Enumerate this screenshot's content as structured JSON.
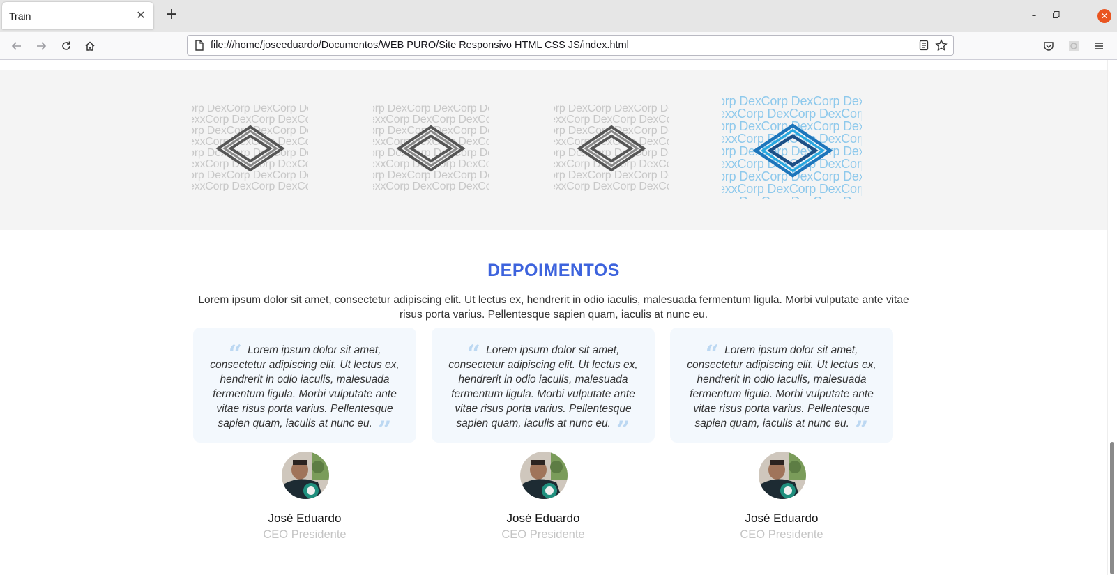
{
  "browser": {
    "tab_title": "Train",
    "tab_close": "✕",
    "new_tab": "+",
    "url": "file:///home/joseeduardo/Documentos/WEB PURO/Site Responsivo HTML CSS JS/index.html",
    "window_controls": {
      "minimize": "–",
      "maximize": "▫",
      "close": "✕"
    }
  },
  "logos": {
    "pattern_word": "DexCorp",
    "pattern_first_fragment": "orp",
    "tiles": [
      {
        "state": "grayscale",
        "stroke": "#555555"
      },
      {
        "state": "grayscale",
        "stroke": "#555555"
      },
      {
        "state": "grayscale",
        "stroke": "#555555"
      },
      {
        "state": "color",
        "stroke_primary": "#1d75bb",
        "stroke_secondary": "#29a8e0",
        "stroke_dark": "#1c4f86"
      }
    ]
  },
  "testimonials": {
    "title": "DEPOIMENTOS",
    "lead": "Lorem ipsum dolor sit amet, consectetur adipiscing elit. Ut lectus ex, hendrerit in odio iaculis, malesuada fermentum ligula. Morbi vulputate ante vitae risus porta varius. Pellentesque sapien quam, iaculis at nunc eu.",
    "items": [
      {
        "quote": "Lorem ipsum dolor sit amet, consectetur adipiscing elit. Ut lectus ex, hendrerit in odio iaculis, malesuada fermentum ligula. Morbi vulputate ante vitae risus porta varius. Pellentesque sapien quam, iaculis at nunc eu.",
        "name": "José Eduardo",
        "role": "CEO Presidente"
      },
      {
        "quote": "Lorem ipsum dolor sit amet, consectetur adipiscing elit. Ut lectus ex, hendrerit in odio iaculis, malesuada fermentum ligula. Morbi vulputate ante vitae risus porta varius. Pellentesque sapien quam, iaculis at nunc eu.",
        "name": "José Eduardo",
        "role": "CEO Presidente"
      },
      {
        "quote": "Lorem ipsum dolor sit amet, consectetur adipiscing elit. Ut lectus ex, hendrerit in odio iaculis, malesuada fermentum ligula. Morbi vulputate ante vitae risus porta varius. Pellentesque sapien quam, iaculis at nunc eu.",
        "name": "José Eduardo",
        "role": "CEO Presidente"
      }
    ]
  },
  "colors": {
    "accent": "#3d63dd",
    "card_bg": "#f3f8fd",
    "quote_mark": "#bcd8f2",
    "role_text": "#c4c4c4",
    "band_bg": "#f4f4f4",
    "ubuntu_close": "#e95420"
  }
}
